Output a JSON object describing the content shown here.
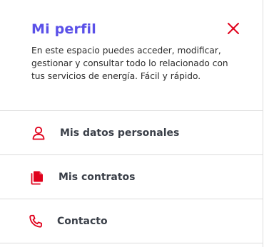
{
  "panel": {
    "title": "Mi perfil",
    "description": "En este espacio puedes acceder, modificar, gestionar y consultar todo lo relacionado con tus servicios de energía. Fácil y rápido.",
    "close_icon": "close-icon"
  },
  "menu": {
    "items": [
      {
        "label": "Mis datos personales",
        "icon": "user-icon"
      },
      {
        "label": "Mis contratos",
        "icon": "documents-icon"
      },
      {
        "label": "Contacto",
        "icon": "phone-icon"
      }
    ]
  },
  "colors": {
    "title": "#5a50e8",
    "accent": "#e0001b",
    "text": "#3a3f48",
    "divider": "#dcdcdc"
  }
}
